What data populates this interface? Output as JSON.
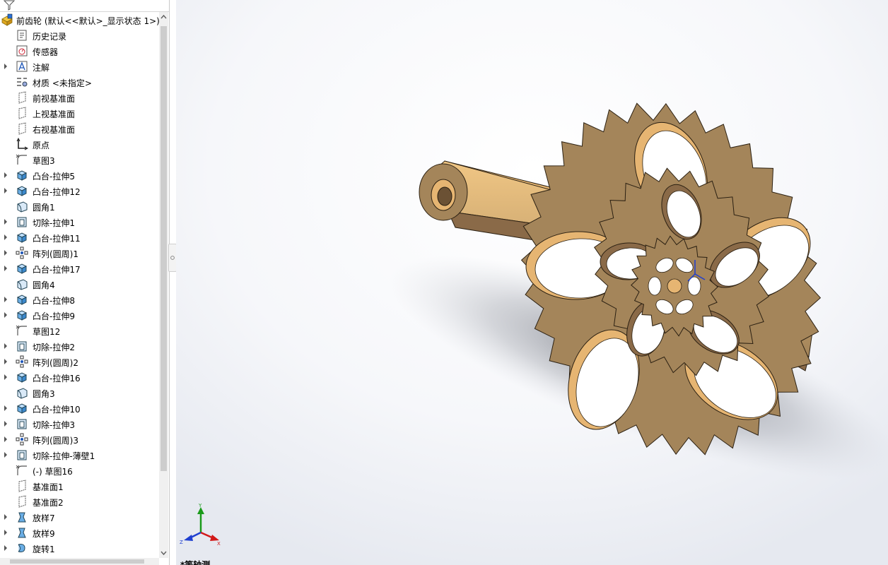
{
  "feature_tree": {
    "root_label": "前齿轮 (默认<<默认>_显示状态 1>)",
    "items": [
      {
        "label": "历史记录",
        "icon": "history-icon",
        "expandable": false
      },
      {
        "label": "传感器",
        "icon": "sensor-icon",
        "expandable": false
      },
      {
        "label": "注解",
        "icon": "annotation-icon",
        "expandable": true
      },
      {
        "label": "材质 <未指定>",
        "icon": "material-icon",
        "expandable": false
      },
      {
        "label": "前视基准面",
        "icon": "plane-icon",
        "expandable": false
      },
      {
        "label": "上视基准面",
        "icon": "plane-icon",
        "expandable": false
      },
      {
        "label": "右视基准面",
        "icon": "plane-icon",
        "expandable": false
      },
      {
        "label": "原点",
        "icon": "origin-icon",
        "expandable": false
      },
      {
        "label": "草图3",
        "icon": "sketch-icon",
        "expandable": false
      },
      {
        "label": "凸台-拉伸5",
        "icon": "boss-extrude-icon",
        "expandable": true
      },
      {
        "label": "凸台-拉伸12",
        "icon": "boss-extrude-icon",
        "expandable": true
      },
      {
        "label": "圆角1",
        "icon": "fillet-icon",
        "expandable": false
      },
      {
        "label": "切除-拉伸1",
        "icon": "cut-extrude-icon",
        "expandable": true
      },
      {
        "label": "凸台-拉伸11",
        "icon": "boss-extrude-icon",
        "expandable": true
      },
      {
        "label": "阵列(圆周)1",
        "icon": "circular-pattern-icon",
        "expandable": true
      },
      {
        "label": "凸台-拉伸17",
        "icon": "boss-extrude-icon",
        "expandable": true
      },
      {
        "label": "圆角4",
        "icon": "fillet-icon",
        "expandable": false
      },
      {
        "label": "凸台-拉伸8",
        "icon": "boss-extrude-icon",
        "expandable": true
      },
      {
        "label": "凸台-拉伸9",
        "icon": "boss-extrude-icon",
        "expandable": true
      },
      {
        "label": "草图12",
        "icon": "sketch-icon",
        "expandable": false
      },
      {
        "label": "切除-拉伸2",
        "icon": "cut-extrude-icon",
        "expandable": true
      },
      {
        "label": "阵列(圆周)2",
        "icon": "circular-pattern-icon",
        "expandable": true
      },
      {
        "label": "凸台-拉伸16",
        "icon": "boss-extrude-icon",
        "expandable": true
      },
      {
        "label": "圆角3",
        "icon": "fillet-icon",
        "expandable": false
      },
      {
        "label": "凸台-拉伸10",
        "icon": "boss-extrude-icon",
        "expandable": true
      },
      {
        "label": "切除-拉伸3",
        "icon": "cut-extrude-icon",
        "expandable": true
      },
      {
        "label": "阵列(圆周)3",
        "icon": "circular-pattern-icon",
        "expandable": true
      },
      {
        "label": "切除-拉伸-薄壁1",
        "icon": "cut-extrude-icon",
        "expandable": true
      },
      {
        "label": "(-) 草图16",
        "icon": "sketch-icon",
        "expandable": false
      },
      {
        "label": "基准面1",
        "icon": "plane-icon",
        "expandable": false
      },
      {
        "label": "基准面2",
        "icon": "plane-icon",
        "expandable": false
      },
      {
        "label": "放样7",
        "icon": "loft-icon",
        "expandable": true
      },
      {
        "label": "放样9",
        "icon": "loft-icon",
        "expandable": true
      },
      {
        "label": "旋转1",
        "icon": "revolve-icon",
        "expandable": true
      }
    ]
  },
  "viewport": {
    "view_label": "*等轴测",
    "triad_axes": {
      "x": "X",
      "y": "Y",
      "z": "Z"
    }
  },
  "colors": {
    "part_face": "#a4855a",
    "part_highlight": "#e6b572",
    "part_inner": "#8a6a48",
    "edge": "#2b2012",
    "axis_x": "#d21919",
    "axis_y": "#1a9a1a",
    "axis_z": "#1f3fd0"
  }
}
